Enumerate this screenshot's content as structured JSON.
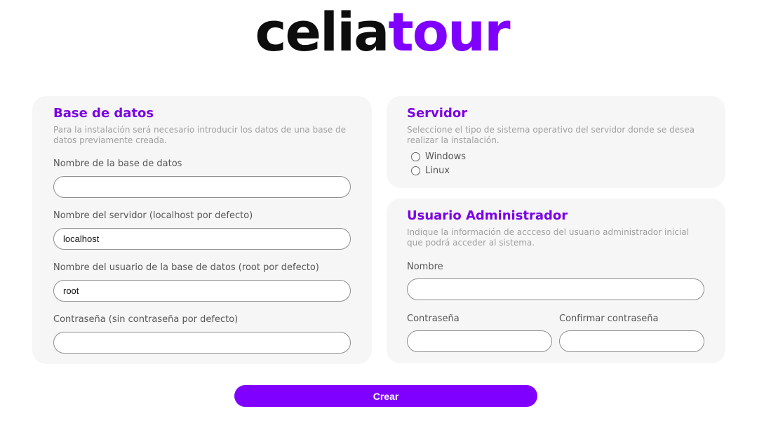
{
  "logo": {
    "part1": "celia",
    "part2": "tour"
  },
  "database": {
    "title": "Base de datos",
    "description": "Para la instalación será necesario introducir los datos de una base de datos previamente creada.",
    "fields": [
      {
        "label": "Nombre de la base de datos",
        "value": ""
      },
      {
        "label": "Nombre del servidor (localhost por defecto)",
        "value": "localhost"
      },
      {
        "label": "Nombre del usuario de la base de datos (root por defecto)",
        "value": "root"
      },
      {
        "label": "Contraseña (sin contraseña por defecto)",
        "value": ""
      }
    ]
  },
  "server": {
    "title": "Servidor",
    "description": "Seleccione el tipo de sistema operativo del servidor donde se desea realizar la instalación.",
    "options": [
      {
        "label": "Windows",
        "selected": false
      },
      {
        "label": "Linux",
        "selected": false
      }
    ]
  },
  "admin": {
    "title": "Usuario Administrador",
    "description": "Indique la información de accceso del usuario administrador inicial que podrá acceder al sistema.",
    "name_label": "Nombre",
    "name_value": "",
    "password_label": "Contraseña",
    "password_value": "",
    "confirm_label": "Confirmar contraseña",
    "confirm_value": ""
  },
  "submit_label": "Crear",
  "colors": {
    "accent": "#8000ff",
    "title": "#7b00e6",
    "card": "#f6f6f6"
  }
}
